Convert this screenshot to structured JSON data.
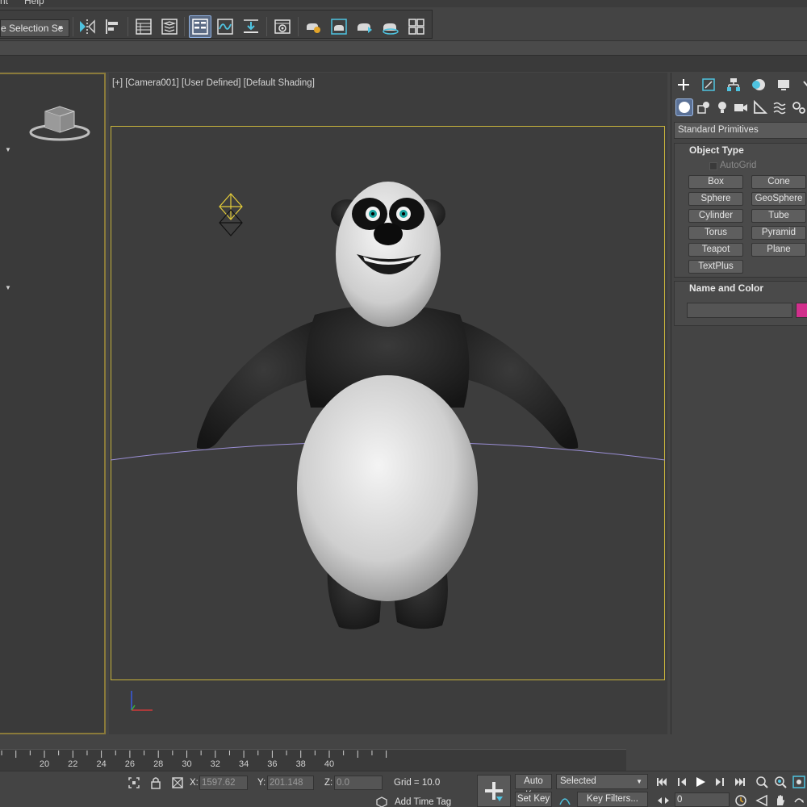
{
  "menu": {
    "items": [
      "nt",
      "Help"
    ]
  },
  "toolbar": {
    "selection_set": {
      "value": "e Selection Se"
    },
    "buttons": [
      "mirror-icon",
      "align-icon",
      "scene-explorer-icon",
      "layer-explorer-icon",
      "toggle-ribbon-icon",
      "curve-editor-icon",
      "schematic-view-icon",
      "material-editor-icon",
      "render-setup-icon",
      "rendered-frame-icon",
      "render-icon",
      "render-iterative-icon",
      "render-online-icon",
      "render-gallery-icon"
    ]
  },
  "viewport": {
    "label": "[+] [Camera001] [User Defined] [Default Shading]"
  },
  "command_panel": {
    "tabs": [
      "create-icon",
      "modify-icon",
      "hierarchy-icon",
      "motion-icon",
      "display-icon",
      "utilities-icon"
    ],
    "subtabs": [
      "geometry-icon",
      "shapes-icon",
      "lights-icon",
      "cameras-icon",
      "helpers-icon",
      "space-warps-icon",
      "systems-icon"
    ],
    "category": "Standard Primitives",
    "object_type": {
      "title": "Object Type",
      "autogrid": "AutoGrid",
      "buttons": [
        "Box",
        "Cone",
        "Sphere",
        "GeoSphere",
        "Cylinder",
        "Tube",
        "Torus",
        "Pyramid",
        "Teapot",
        "Plane",
        "TextPlus"
      ]
    },
    "name_and_color": {
      "title": "Name and Color",
      "name_value": "",
      "color": "#d12f8c"
    }
  },
  "timeline": {
    "ticks": [
      "20",
      "22",
      "24",
      "26",
      "28",
      "30",
      "32",
      "34",
      "36",
      "38",
      "40"
    ]
  },
  "status": {
    "x_label": "X:",
    "x_value": "1597.62",
    "y_label": "Y:",
    "y_value": "201.148",
    "z_label": "Z:",
    "z_value": "0.0",
    "grid": "Grid = 10.0",
    "add_time_tag": "Add Time Tag",
    "auto_key": "Auto Key",
    "set_key": "Set Key",
    "selected": "Selected",
    "key_filters": "Key Filters...",
    "frame": "0"
  },
  "colors": {
    "safe_frame": "#c8b43c",
    "active_button": "#5a6a84",
    "accent_swatch": "#d12f8c",
    "horizon_line": "#9b8fd6"
  }
}
